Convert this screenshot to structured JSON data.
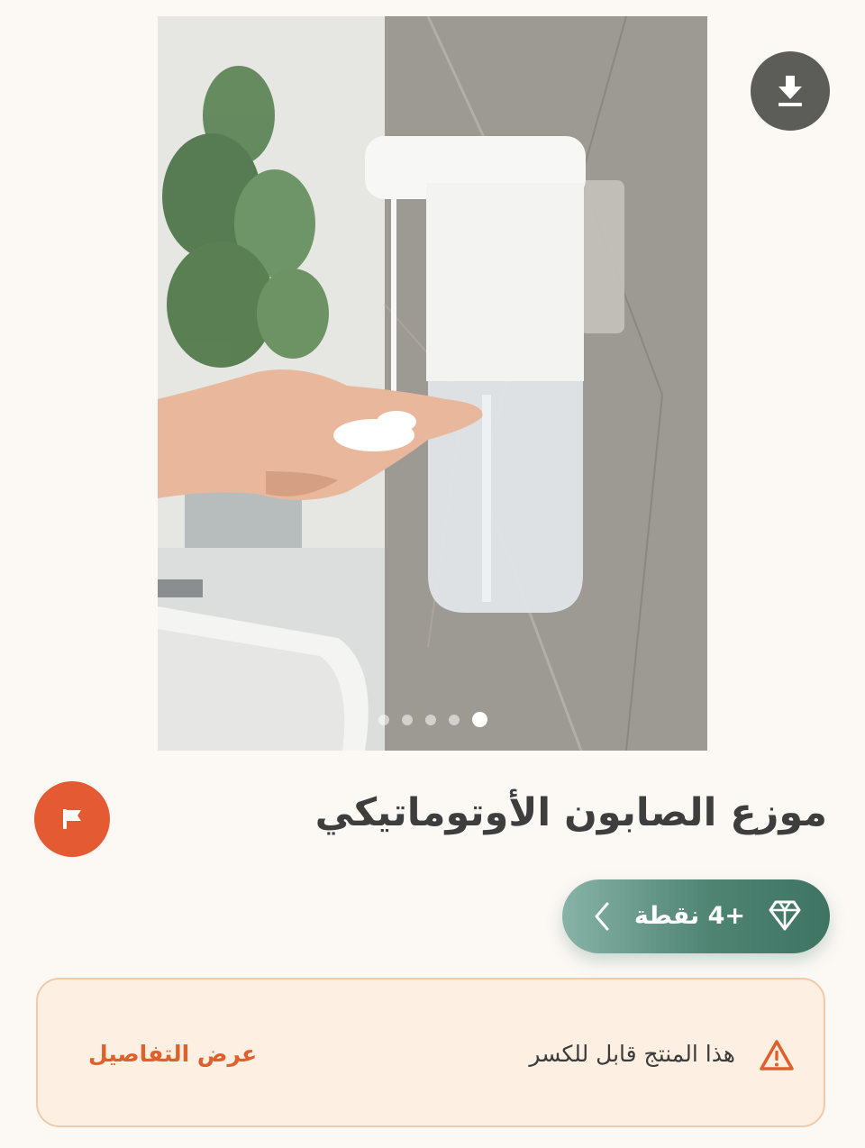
{
  "product": {
    "title": "موزع الصابون الأوتوماتيكي",
    "gallery": {
      "image_count": 5,
      "active_index": 4
    }
  },
  "points": {
    "label": "+4 نقطة",
    "icon": "diamond-icon"
  },
  "notice": {
    "message": "هذا المنتج قابل للكسر",
    "link_label": "عرض التفاصيل",
    "icon": "warning-icon"
  },
  "colors": {
    "accent": "#e45a32",
    "points_green": "#4f8473",
    "notice_bg": "#fdf0e2",
    "notice_border": "#f2c9a8"
  }
}
